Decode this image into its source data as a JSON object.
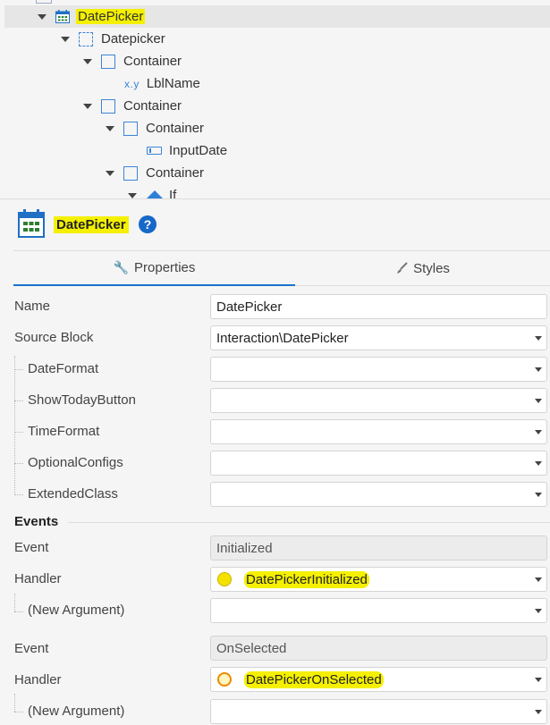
{
  "tree": {
    "items": [
      {
        "label": "DatePicker",
        "icon": "calendar-icon"
      },
      {
        "label": "Datepicker",
        "icon": "placeholder-dashed-icon"
      },
      {
        "label": "Container",
        "icon": "container-icon"
      },
      {
        "label": "LblName",
        "icon": "expression-icon",
        "icon_text": "x.y"
      },
      {
        "label": "Container",
        "icon": "container-icon"
      },
      {
        "label": "Container",
        "icon": "container-icon"
      },
      {
        "label": "InputDate",
        "icon": "input-icon"
      },
      {
        "label": "Container",
        "icon": "container-icon"
      },
      {
        "label": "If",
        "icon": "if-icon"
      }
    ]
  },
  "header": {
    "title": "DatePicker",
    "help": "?"
  },
  "tabs": {
    "properties": "Properties",
    "styles": "Styles"
  },
  "props": {
    "name": {
      "label": "Name",
      "value": "DatePicker"
    },
    "source_block": {
      "label": "Source Block",
      "value": "Interaction\\DatePicker"
    },
    "date_format": {
      "label": "DateFormat",
      "value": ""
    },
    "show_today": {
      "label": "ShowTodayButton",
      "value": ""
    },
    "time_format": {
      "label": "TimeFormat",
      "value": ""
    },
    "optional_configs": {
      "label": "OptionalConfigs",
      "value": ""
    },
    "extended_class": {
      "label": "ExtendedClass",
      "value": ""
    }
  },
  "events": {
    "heading": "Events",
    "items": [
      {
        "event_label": "Event",
        "event_value": "Initialized",
        "handler_label": "Handler",
        "handler_value": "DatePickerInitialized",
        "arg_label": "(New Argument)"
      },
      {
        "event_label": "Event",
        "event_value": "OnSelected",
        "handler_label": "Handler",
        "handler_value": "DatePickerOnSelected",
        "arg_label": "(New Argument)"
      }
    ]
  },
  "colors": {
    "highlight": "#f4f000",
    "accent": "#1a73c9",
    "icon_blue": "#3d84d6",
    "calendar_green": "#2e7d32"
  }
}
